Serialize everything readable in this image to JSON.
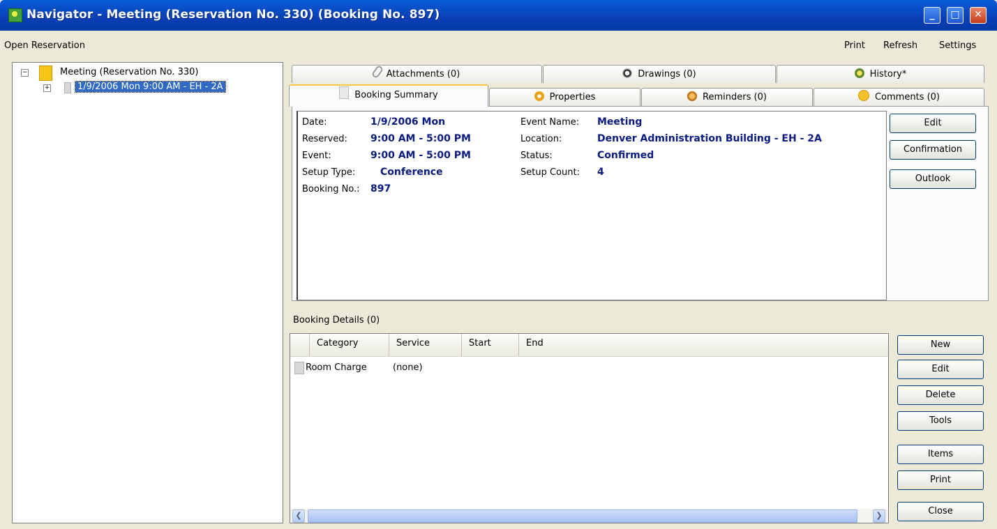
{
  "window": {
    "title": "Navigator - Meeting (Reservation No. 330) (Booking No. 897)",
    "controls": {
      "minimize": "_",
      "maximize": "□",
      "close": "✕"
    }
  },
  "menubar": {
    "left": "Open Reservation",
    "right": [
      "Print",
      "Refresh",
      "Settings"
    ]
  },
  "tree": {
    "root": {
      "expander": "−",
      "label": "Meeting (Reservation No. 330)"
    },
    "child": {
      "expander": "+",
      "label": "1/9/2006 Mon 9:00 AM - EH - 2A"
    }
  },
  "tabs": {
    "top_row": [
      {
        "label": "Attachments (0)",
        "icon": "paperclip-icon"
      },
      {
        "label": "Drawings (0)",
        "icon": "drawings-icon"
      },
      {
        "label": "History*",
        "icon": "history-icon"
      }
    ],
    "bottom_row": [
      {
        "label": "Booking Summary",
        "icon": "page-icon"
      },
      {
        "label": "Properties",
        "icon": "gear-icon"
      },
      {
        "label": "Reminders (0)",
        "icon": "reminder-icon"
      },
      {
        "label": "Comments (0)",
        "icon": "comment-icon"
      }
    ]
  },
  "summary": {
    "date_label": "Date:",
    "date_value": "1/9/2006 Mon",
    "reserved_label": "Reserved:",
    "reserved_value": "9:00 AM - 5:00 PM",
    "event_label": "Event:",
    "event_value": "9:00 AM - 5:00 PM",
    "setup_type_label": "Setup Type:",
    "setup_type_value": "Conference",
    "booking_no_label": "Booking No.:",
    "booking_no_value": "897",
    "event_name_label": "Event Name:",
    "event_name_value": "Meeting",
    "location_label": "Location:",
    "location_value": "Denver Administration Building - EH - 2A",
    "status_label": "Status:",
    "status_value": "Confirmed",
    "setup_count_label": "Setup Count:",
    "setup_count_value": "4"
  },
  "summary_buttons": [
    "Edit",
    "Confirmation",
    "Outlook"
  ],
  "booking_details": {
    "title": "Booking Details (0)",
    "columns": [
      "Category",
      "Service",
      "Start",
      "End"
    ],
    "rows": [
      {
        "category": "Room Charge",
        "service": "(none)"
      }
    ]
  },
  "details_buttons": [
    "New",
    "Edit",
    "Delete",
    "Tools",
    "Items",
    "Print",
    "Close"
  ],
  "colors": {
    "title_bar": "#0a4fd0",
    "value_text": "#0a1a80",
    "active_tab_accent": "#ffc83c"
  }
}
